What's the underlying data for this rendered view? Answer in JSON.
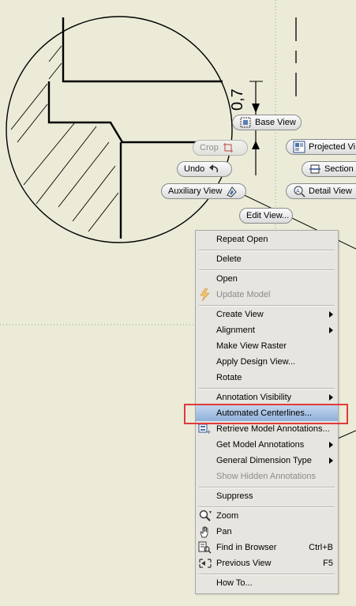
{
  "drawing": {
    "dimension_value": "0,7"
  },
  "glyph_buttons": {
    "base_view": "Base View",
    "crop": "Crop",
    "projected_view": "Projected Vi",
    "undo": "Undo",
    "section": "Section",
    "auxiliary_view": "Auxiliary View",
    "detail_view": "Detail View",
    "edit_view": "Edit View..."
  },
  "context_menu": {
    "repeat_open": "Repeat Open",
    "delete": "Delete",
    "open": "Open",
    "update_model": "Update Model",
    "create_view": "Create View",
    "alignment": "Alignment",
    "make_view_raster": "Make View Raster",
    "apply_design_view": "Apply Design View...",
    "rotate": "Rotate",
    "annotation_visibility": "Annotation Visibility",
    "automated_centerlines": "Automated Centerlines...",
    "retrieve_model_annotations": "Retrieve Model Annotations...",
    "get_model_annotations": "Get Model Annotations",
    "general_dimension_type": "General Dimension Type",
    "show_hidden_annotations": "Show Hidden Annotations",
    "suppress": "Suppress",
    "zoom": "Zoom",
    "pan": "Pan",
    "find_in_browser": "Find in Browser",
    "find_in_browser_shortcut": "Ctrl+B",
    "previous_view": "Previous View",
    "previous_view_shortcut": "F5",
    "how_to": "How To..."
  },
  "colors": {
    "canvas_bg": "#ecebd8",
    "highlight": "#8fb0da",
    "callout": "#e03a3a"
  }
}
